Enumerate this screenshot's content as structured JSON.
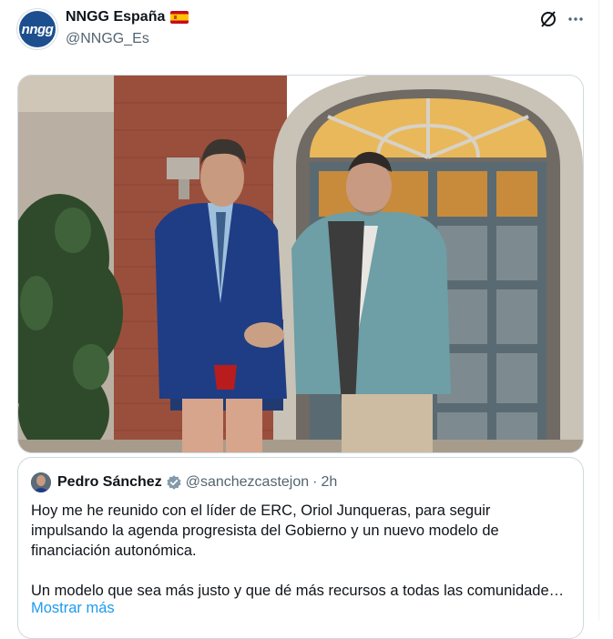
{
  "post": {
    "avatar_text": "nngg",
    "display_name": "NNGG España",
    "handle": "@NNGG_Es",
    "flag_icon": "spain-flag-icon"
  },
  "actions": {
    "grok": "grok-icon",
    "more": "more-options-icon"
  },
  "quoted": {
    "display_name": "Pedro Sánchez",
    "handle": "@sanchezcastejon",
    "separator": "·",
    "time": "2h",
    "verified_color": "#829aab",
    "text_line_1": "Hoy me he reunido con el líder de ERC, Oriol Junqueras, para seguir",
    "text_line_2": "impulsando la agenda progresista del Gobierno y un nuevo modelo de",
    "text_line_3": "financiación autonómica.",
    "text_line_4": "Un modelo que sea más justo y que dé más recursos a todas las comunidade…",
    "show_more": "Mostrar más"
  },
  "colors": {
    "link": "#1d9bf0",
    "secondary": "#536471",
    "border": "#cfd9de"
  }
}
